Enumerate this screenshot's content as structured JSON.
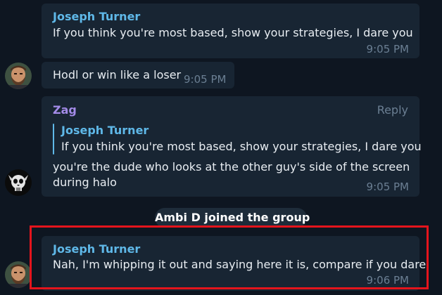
{
  "messages": [
    {
      "sender": "Joseph Turner",
      "text": "If you think you're most based, show your strategies, I dare you",
      "time": "9:05 PM"
    },
    {
      "text": "Hodl or win like a loser",
      "time": "9:05 PM"
    },
    {
      "sender": "Zag",
      "reply_action": "Reply",
      "quote": {
        "sender": "Joseph Turner",
        "text": "If you think you're most based, show your strategies, I dare you"
      },
      "text_line1": "you're the dude who looks at the other guy's side of the screen",
      "text_line2": "during halo",
      "time": "9:05 PM"
    },
    {
      "sender": "Joseph Turner",
      "text": "Nah, I'm whipping it out and saying here it is, compare if you dare",
      "time": "9:06 PM"
    }
  ],
  "service_message": "Ambi D joined the group",
  "avatars": [
    {
      "name": "bearded-man-avatar"
    },
    {
      "name": "skull-avatar"
    },
    {
      "name": "bearded-man-avatar"
    }
  ],
  "colors": {
    "background": "#0e1621",
    "bubble": "#182533",
    "sender_joseph": "#5fb8e8",
    "sender_zag": "#a38be8",
    "highlight": "#e4141c"
  }
}
